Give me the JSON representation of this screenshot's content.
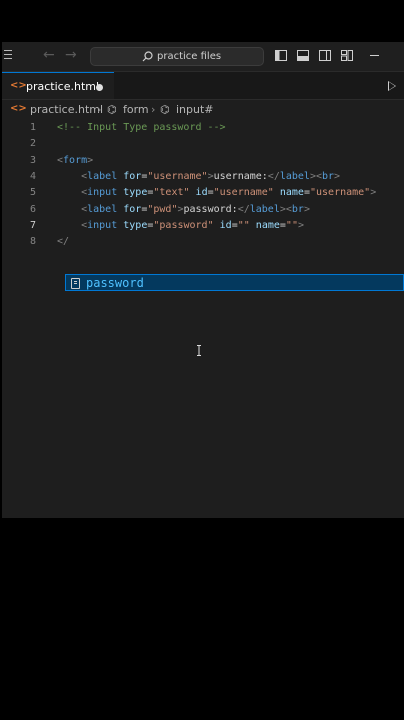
{
  "titlebar": {
    "search_text": "practice files"
  },
  "tab": {
    "label": "practice.html",
    "icon": "<>"
  },
  "breadcrumb": {
    "file": "practice.html",
    "element1": "form",
    "element2": "input#"
  },
  "editor": {
    "lines": [
      {
        "number": "1",
        "tokens": [
          [
            "cmt",
            "<!-- Input Type password -->"
          ]
        ]
      },
      {
        "number": "2",
        "tokens": []
      },
      {
        "number": "3",
        "tokens": [
          [
            "p",
            "<"
          ],
          [
            "tag",
            "form"
          ],
          [
            "p",
            ">"
          ]
        ]
      },
      {
        "number": "4",
        "tokens": [
          [
            "txt",
            "    "
          ],
          [
            "p",
            "<"
          ],
          [
            "tag",
            "label"
          ],
          [
            "txt",
            " "
          ],
          [
            "attr",
            "for"
          ],
          [
            "txt",
            "="
          ],
          [
            "str",
            "\"username\""
          ],
          [
            "p",
            ">"
          ],
          [
            "txt",
            "username:"
          ],
          [
            "p",
            "</"
          ],
          [
            "tag",
            "label"
          ],
          [
            "p",
            "><"
          ],
          [
            "tag",
            "br"
          ],
          [
            "p",
            ">"
          ]
        ]
      },
      {
        "number": "5",
        "tokens": [
          [
            "txt",
            "    "
          ],
          [
            "p",
            "<"
          ],
          [
            "tag",
            "input"
          ],
          [
            "txt",
            " "
          ],
          [
            "attr",
            "type"
          ],
          [
            "txt",
            "="
          ],
          [
            "str",
            "\"text\""
          ],
          [
            "txt",
            " "
          ],
          [
            "attr",
            "id"
          ],
          [
            "txt",
            "="
          ],
          [
            "str",
            "\"username\""
          ],
          [
            "txt",
            " "
          ],
          [
            "attr",
            "name"
          ],
          [
            "txt",
            "="
          ],
          [
            "str",
            "\"username\""
          ],
          [
            "p",
            ">"
          ]
        ]
      },
      {
        "number": "6",
        "tokens": [
          [
            "txt",
            "    "
          ],
          [
            "p",
            "<"
          ],
          [
            "tag",
            "label"
          ],
          [
            "txt",
            " "
          ],
          [
            "attr",
            "for"
          ],
          [
            "txt",
            "="
          ],
          [
            "str",
            "\"pwd\""
          ],
          [
            "p",
            ">"
          ],
          [
            "txt",
            "password:"
          ],
          [
            "p",
            "</"
          ],
          [
            "tag",
            "label"
          ],
          [
            "p",
            "><"
          ],
          [
            "tag",
            "br"
          ],
          [
            "p",
            ">"
          ]
        ]
      },
      {
        "number": "7",
        "tokens": [
          [
            "txt",
            "    "
          ],
          [
            "p",
            "<"
          ],
          [
            "tag",
            "input"
          ],
          [
            "txt",
            " "
          ],
          [
            "attr",
            "type"
          ],
          [
            "txt",
            "="
          ],
          [
            "str",
            "\"password\""
          ],
          [
            "txt",
            " "
          ],
          [
            "attr",
            "id"
          ],
          [
            "txt",
            "="
          ],
          [
            "str",
            "\"\""
          ],
          [
            "txt",
            " "
          ],
          [
            "attr",
            "name"
          ],
          [
            "txt",
            "="
          ],
          [
            "str",
            "\"\""
          ],
          [
            "p",
            ">"
          ]
        ]
      },
      {
        "number": "8",
        "tokens": [
          [
            "p",
            "</"
          ]
        ]
      }
    ],
    "active_line": "7"
  },
  "suggestion": {
    "label": "password"
  },
  "colors": {
    "accent": "#0078d4",
    "comment": "#6a9955",
    "tag": "#569cd6",
    "attribute": "#9cdcfe",
    "string": "#ce9178"
  }
}
